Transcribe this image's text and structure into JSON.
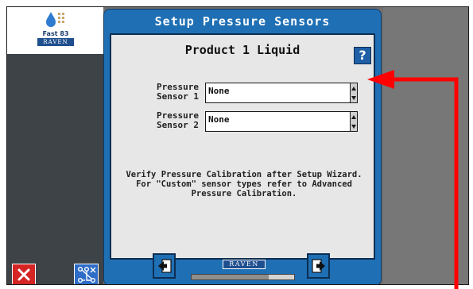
{
  "app": {
    "logo": {
      "line1": "Fast 83",
      "brand": "RAVEN"
    }
  },
  "panel": {
    "title": "Setup Pressure Sensors",
    "product_title": "Product 1 Liquid",
    "help_label": "?"
  },
  "sensors": [
    {
      "label": "Pressure Sensor 1",
      "value": "None"
    },
    {
      "label": "Pressure Sensor 2",
      "value": "None"
    }
  ],
  "info_text": "Verify Pressure Calibration after Setup Wizard. For \"Custom\" sensor types refer to Advanced Pressure Calibration.",
  "footer": {
    "brand": "RAVEN",
    "progress_fraction": 0.75
  },
  "icons": {
    "close": "close-icon",
    "config": "network-config-icon",
    "back": "back-arrow-icon",
    "next": "next-arrow-icon"
  },
  "colors": {
    "panel_blue": "#1f6fb4",
    "close_red": "#d42424",
    "annotation_red": "#ff0000"
  }
}
